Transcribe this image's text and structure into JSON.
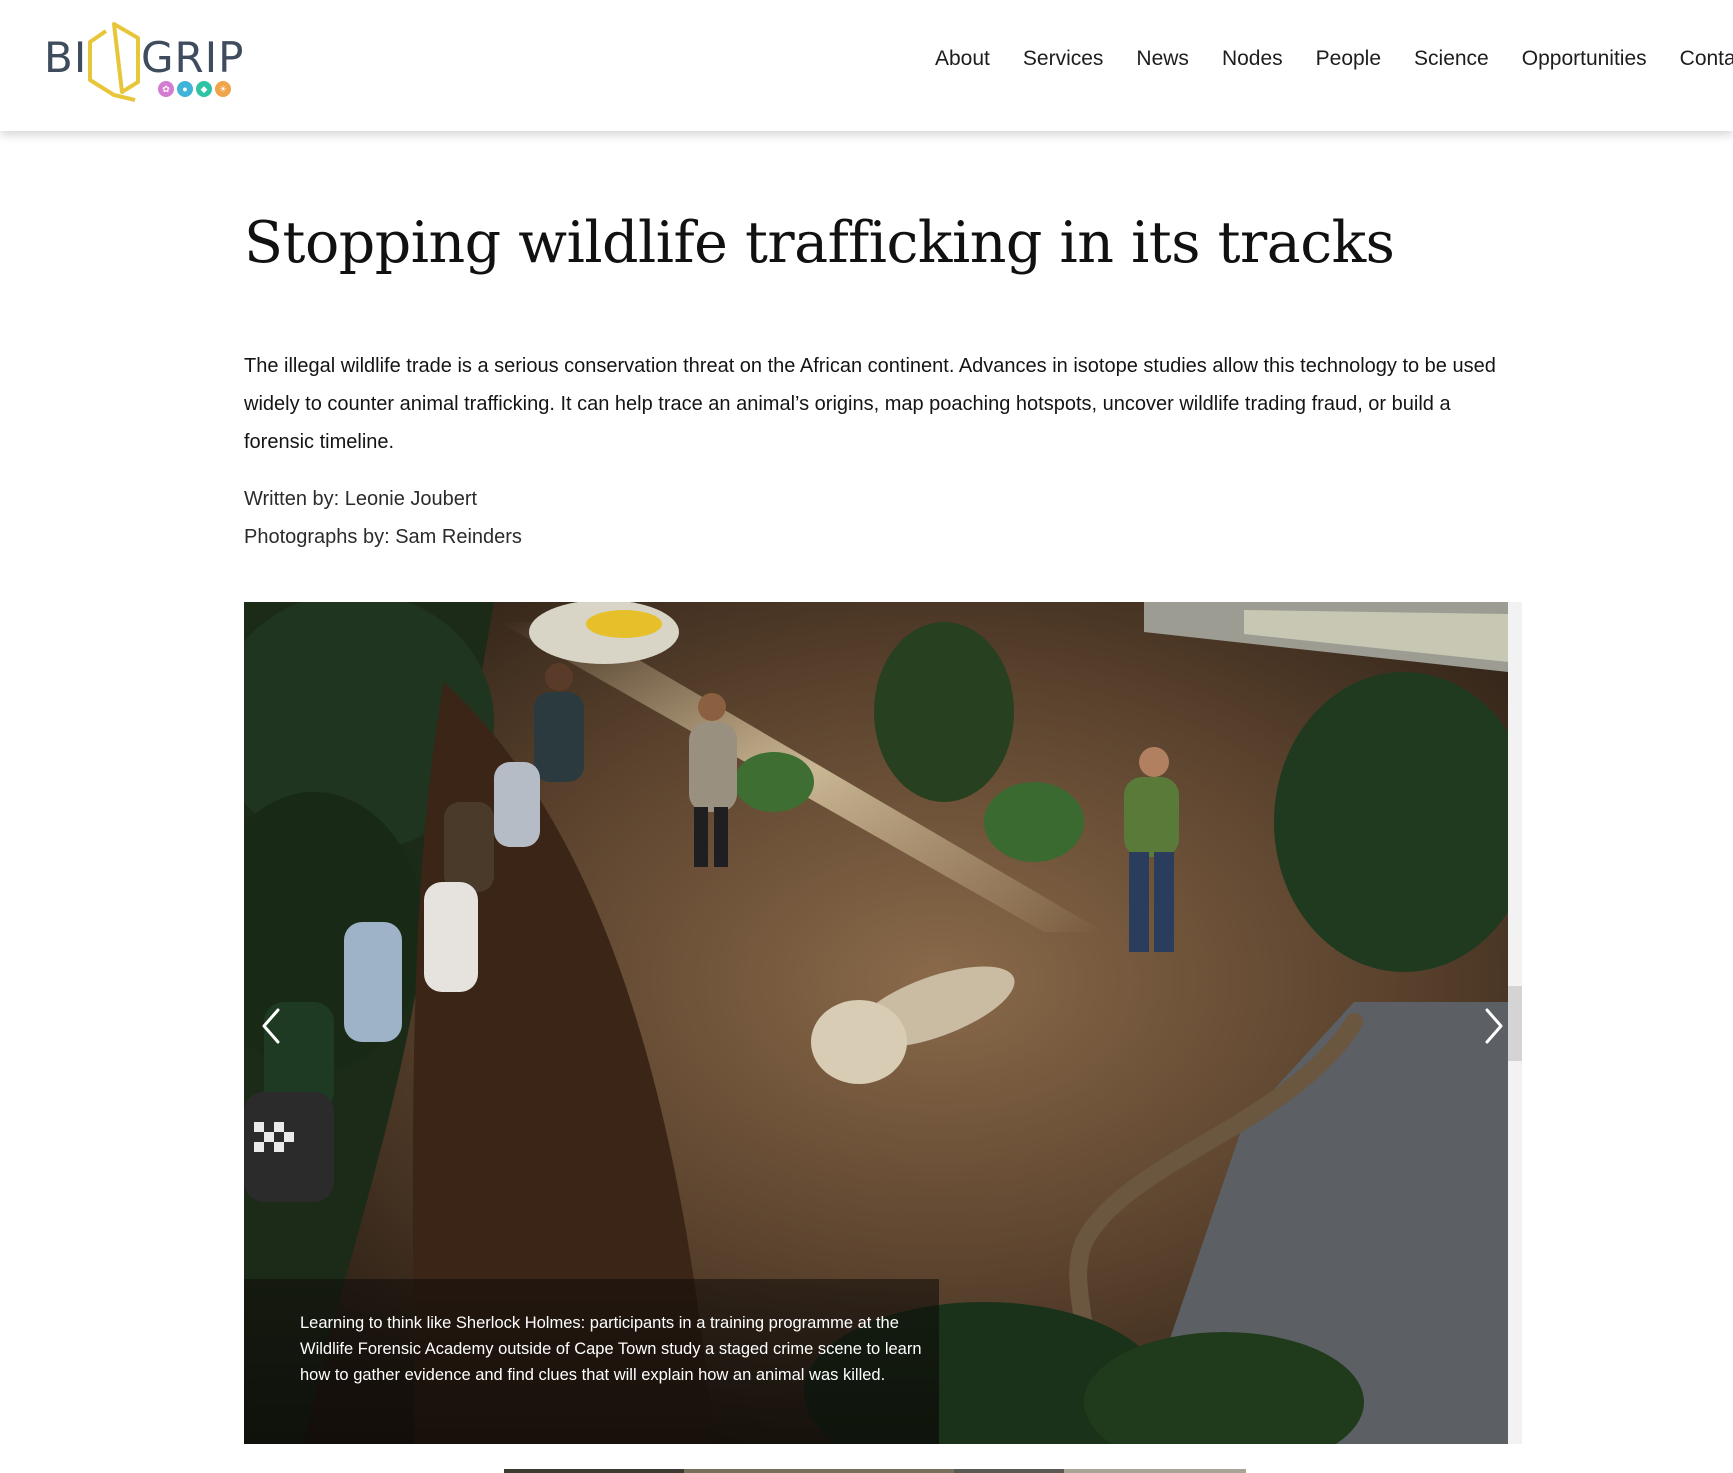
{
  "header": {
    "logo": {
      "text_left": "BI",
      "text_right": "GRIP",
      "hex_color": "#e8c63a",
      "text_color": "#3f4c5e",
      "dots": [
        {
          "icon": "flower-icon",
          "color": "#d47bd2"
        },
        {
          "icon": "paw-icon",
          "color": "#3fb4d9"
        },
        {
          "icon": "leaf-icon",
          "color": "#2fc3a6"
        },
        {
          "icon": "sun-icon",
          "color": "#f0a44a"
        }
      ]
    },
    "nav": [
      {
        "label": "About"
      },
      {
        "label": "Services"
      },
      {
        "label": "News"
      },
      {
        "label": "Nodes"
      },
      {
        "label": "People"
      },
      {
        "label": "Science"
      },
      {
        "label": "Opportunities"
      },
      {
        "label": "Contact"
      }
    ]
  },
  "article": {
    "title": "Stopping wildlife trafficking in its tracks",
    "lead": "The illegal wildlife trade is a serious conservation threat on the African continent. Advances in isotope studies allow this technology to be used widely to counter animal trafficking. It can help trace an animal’s origins, map poaching hotspots, uncover wildlife trading fraud, or build a forensic timeline.",
    "written_by": "Written by: Leonie Joubert",
    "photographs_by": "Photographs by: Sam Reinders"
  },
  "slider": {
    "caption": "Learning to think like Sherlock Holmes: participants in a training programme at the Wildlife Forensic Academy outside of Cape Town study a staged crime scene to learn how to gather evidence and find clues that will explain how an animal was killed.",
    "prev_icon": "chevron-left-icon",
    "next_icon": "chevron-right-icon"
  }
}
